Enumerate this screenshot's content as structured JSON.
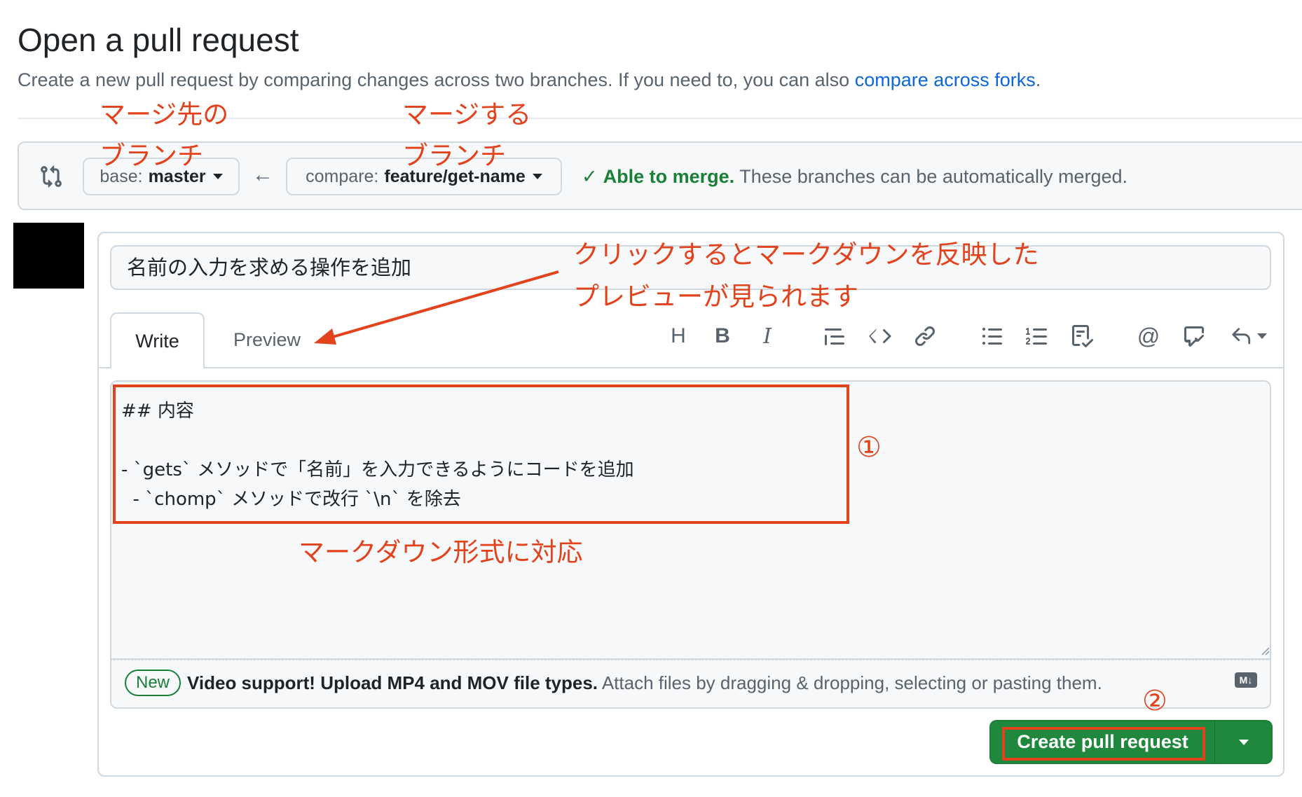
{
  "header": {
    "title": "Open a pull request",
    "subtitle": "Create a new pull request by comparing changes across two branches. If you need to, you can also ",
    "compare_forks_link": "compare across forks",
    "subtitle_end": "."
  },
  "branches": {
    "base_label": "base:",
    "base_value": "master",
    "arrow": "←",
    "compare_label": "compare:",
    "compare_value": "feature/get-name",
    "merge_ok": "Able to merge.",
    "merge_desc": " These branches can be automatically merged."
  },
  "form": {
    "title_value": "名前の入力を求める操作を追加",
    "tabs": {
      "write": "Write",
      "preview": "Preview"
    },
    "toolbar": {
      "heading": "H",
      "bold": "B",
      "italic": "I",
      "quote": "quote-icon",
      "code": "code-icon",
      "link": "link-icon",
      "unordered_list": "unordered-list-icon",
      "ordered_list": "ordered-list-icon",
      "task_list": "task-list-icon",
      "mention": "@",
      "reference": "cross-reference-icon",
      "reply": "reply-icon"
    },
    "body_lines": [
      "## 内容",
      "",
      "- `gets` メソッドで「名前」を入力できるようにコードを追加",
      "  - `chomp` メソッドで改行 `\\n` を除去"
    ],
    "footer_badge": "New",
    "footer_bold": "Video support! Upload MP4 and MOV file types.",
    "footer_text": " Attach files by dragging & dropping, selecting or pasting them.",
    "markdown_icon": "M↓",
    "submit_label": "Create pull request"
  },
  "annotations": {
    "base_line1": "マージ先の",
    "base_line2": "ブランチ",
    "compare_line1": "マージする",
    "compare_line2": "ブランチ",
    "preview_line1": "クリックするとマークダウンを反映した",
    "preview_line2": "プレビューが見られます",
    "markdown_note": "マークダウン形式に対応",
    "step1": "①",
    "step2": "②"
  },
  "colors": {
    "annotation_red": "#e2421c",
    "success_green": "#1a7f37",
    "button_green": "#1f883d",
    "link_blue": "#0969da"
  }
}
